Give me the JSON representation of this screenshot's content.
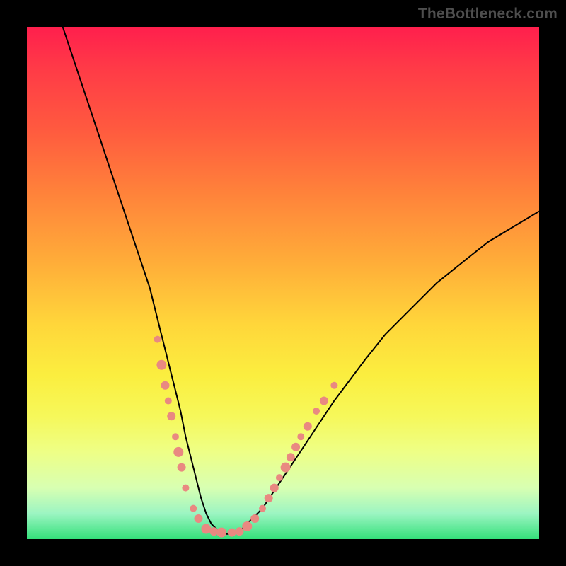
{
  "watermark": "TheBottleneck.com",
  "colors": {
    "gradient_top": "#ff1f4d",
    "gradient_bottom": "#34e07a",
    "curve": "#000000",
    "markers": "#e98981",
    "frame": "#000000"
  },
  "chart_data": {
    "type": "line",
    "title": "",
    "xlabel": "",
    "ylabel": "",
    "xlim": [
      0,
      100
    ],
    "ylim": [
      0,
      100
    ],
    "grid": false,
    "legend": false,
    "series": [
      {
        "name": "bottleneck-curve",
        "x": [
          6,
          8,
          10,
          12,
          14,
          16,
          18,
          20,
          22,
          24,
          25,
          26,
          27,
          28,
          29,
          30,
          31,
          32,
          33,
          34,
          35,
          36,
          37,
          38,
          39,
          40,
          42,
          44,
          46,
          48,
          50,
          52,
          54,
          56,
          58,
          60,
          63,
          66,
          70,
          75,
          80,
          85,
          90,
          95,
          100
        ],
        "y": [
          103,
          97,
          91,
          85,
          79,
          73,
          67,
          61,
          55,
          49,
          45,
          41,
          37,
          33,
          29,
          25,
          20,
          16,
          12,
          8,
          5,
          3,
          2,
          1,
          1,
          1,
          2,
          4,
          6,
          9,
          12,
          15,
          18,
          21,
          24,
          27,
          31,
          35,
          40,
          45,
          50,
          54,
          58,
          61,
          64
        ]
      }
    ],
    "markers": [
      {
        "x": 25.5,
        "y": 39,
        "r": 5
      },
      {
        "x": 26.3,
        "y": 34,
        "r": 7
      },
      {
        "x": 27.0,
        "y": 30,
        "r": 6
      },
      {
        "x": 27.6,
        "y": 27,
        "r": 5
      },
      {
        "x": 28.2,
        "y": 24,
        "r": 6
      },
      {
        "x": 29.0,
        "y": 20,
        "r": 5
      },
      {
        "x": 29.6,
        "y": 17,
        "r": 7
      },
      {
        "x": 30.2,
        "y": 14,
        "r": 6
      },
      {
        "x": 31.0,
        "y": 10,
        "r": 5
      },
      {
        "x": 32.5,
        "y": 6,
        "r": 5
      },
      {
        "x": 33.5,
        "y": 4,
        "r": 6
      },
      {
        "x": 35.0,
        "y": 2,
        "r": 7
      },
      {
        "x": 36.5,
        "y": 1.5,
        "r": 6
      },
      {
        "x": 38.0,
        "y": 1.3,
        "r": 7
      },
      {
        "x": 40.0,
        "y": 1.3,
        "r": 6
      },
      {
        "x": 41.5,
        "y": 1.5,
        "r": 6
      },
      {
        "x": 43.0,
        "y": 2.5,
        "r": 7
      },
      {
        "x": 44.5,
        "y": 4,
        "r": 6
      },
      {
        "x": 46.0,
        "y": 6,
        "r": 5
      },
      {
        "x": 47.2,
        "y": 8,
        "r": 6
      },
      {
        "x": 48.3,
        "y": 10,
        "r": 6
      },
      {
        "x": 49.3,
        "y": 12,
        "r": 5
      },
      {
        "x": 50.5,
        "y": 14,
        "r": 7
      },
      {
        "x": 51.5,
        "y": 16,
        "r": 6
      },
      {
        "x": 52.5,
        "y": 18,
        "r": 6
      },
      {
        "x": 53.5,
        "y": 20,
        "r": 5
      },
      {
        "x": 54.8,
        "y": 22,
        "r": 6
      },
      {
        "x": 56.5,
        "y": 25,
        "r": 5
      },
      {
        "x": 58.0,
        "y": 27,
        "r": 6
      },
      {
        "x": 60.0,
        "y": 30,
        "r": 5
      }
    ]
  }
}
